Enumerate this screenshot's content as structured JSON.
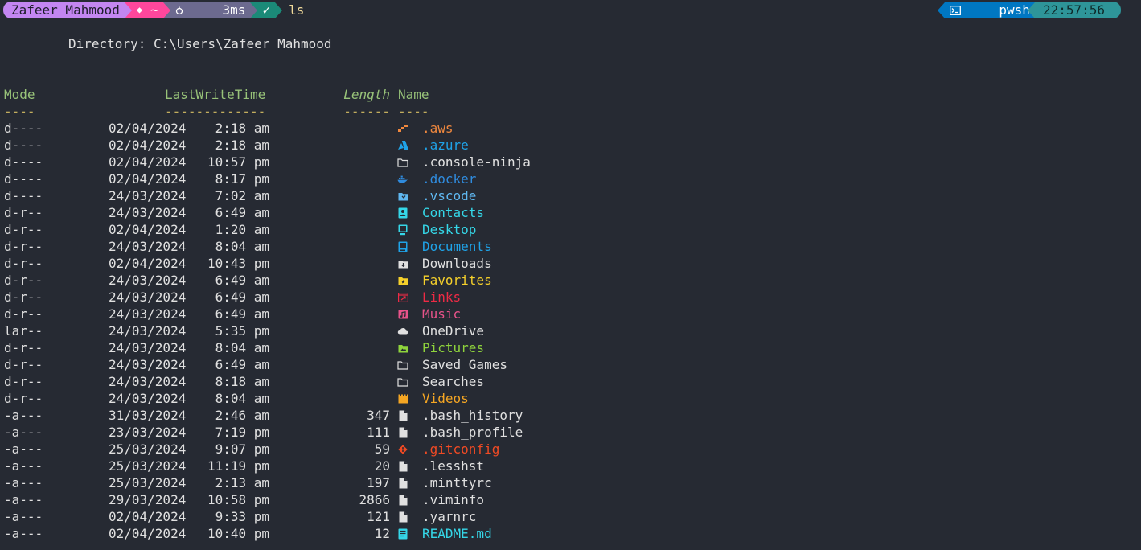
{
  "prompt": {
    "user": "Zafeer Mahmood",
    "git_glyph": "◆",
    "path": "~",
    "duration": "3ms",
    "status": "✓",
    "command": "ls",
    "shell": "pwsh",
    "time": "22:57:56"
  },
  "directory_line": "Directory: C:\\Users\\Zafeer Mahmood",
  "headers": {
    "mode": "Mode",
    "lastwritetime": "LastWriteTime",
    "length": "Length",
    "name": "Name",
    "mode_dash": "----",
    "lwt_dash": "-------------",
    "length_dash": "------",
    "name_dash": "----"
  },
  "colors": {
    "background": "#262a33",
    "user_seg": "#c386f1",
    "git_seg": "#ff479c",
    "path_seg": "#6c6a8f",
    "status_seg": "#1b8a78",
    "shell_seg": "#0077c2",
    "time_seg": "#2e9599"
  },
  "rows": [
    {
      "mode": "d----",
      "date": "02/04/2024",
      "time": "2:18 am",
      "length": "",
      "name": ".aws",
      "icon": "aws-icon",
      "color": "#f0883e"
    },
    {
      "mode": "d----",
      "date": "02/04/2024",
      "time": "2:18 am",
      "length": "",
      "name": ".azure",
      "icon": "azure-icon",
      "color": "#1fa3e8"
    },
    {
      "mode": "d----",
      "date": "02/04/2024",
      "time": "10:57 pm",
      "length": "",
      "name": ".console-ninja",
      "icon": "folder-icon",
      "color": "#e0e0e0"
    },
    {
      "mode": "d----",
      "date": "02/04/2024",
      "time": "8:17 pm",
      "length": "",
      "name": ".docker",
      "icon": "docker-icon",
      "color": "#2f8bde"
    },
    {
      "mode": "d----",
      "date": "24/03/2024",
      "time": "7:02 am",
      "length": "",
      "name": ".vscode",
      "icon": "vscode-icon",
      "color": "#5fb7f0"
    },
    {
      "mode": "d-r--",
      "date": "24/03/2024",
      "time": "6:49 am",
      "length": "",
      "name": "Contacts",
      "icon": "contacts-icon",
      "color": "#35d7e8"
    },
    {
      "mode": "d-r--",
      "date": "02/04/2024",
      "time": "1:20 am",
      "length": "",
      "name": "Desktop",
      "icon": "desktop-icon",
      "color": "#35d7e8"
    },
    {
      "mode": "d-r--",
      "date": "24/03/2024",
      "time": "8:04 am",
      "length": "",
      "name": "Documents",
      "icon": "documents-icon",
      "color": "#1fa3e8"
    },
    {
      "mode": "d-r--",
      "date": "02/04/2024",
      "time": "10:43 pm",
      "length": "",
      "name": "Downloads",
      "icon": "downloads-icon",
      "color": "#e0e0e0"
    },
    {
      "mode": "d-r--",
      "date": "24/03/2024",
      "time": "6:49 am",
      "length": "",
      "name": "Favorites",
      "icon": "favorites-icon",
      "color": "#f5d02b"
    },
    {
      "mode": "d-r--",
      "date": "24/03/2024",
      "time": "6:49 am",
      "length": "",
      "name": "Links",
      "icon": "links-icon",
      "color": "#ee2a45"
    },
    {
      "mode": "d-r--",
      "date": "24/03/2024",
      "time": "6:49 am",
      "length": "",
      "name": "Music",
      "icon": "music-icon",
      "color": "#e8538a"
    },
    {
      "mode": "lar--",
      "date": "24/03/2024",
      "time": "5:35 pm",
      "length": "",
      "name": "OneDrive",
      "icon": "cloud-icon",
      "color": "#e0e0e0"
    },
    {
      "mode": "d-r--",
      "date": "24/03/2024",
      "time": "8:04 am",
      "length": "",
      "name": "Pictures",
      "icon": "pictures-icon",
      "color": "#8fd43c"
    },
    {
      "mode": "d-r--",
      "date": "24/03/2024",
      "time": "6:49 am",
      "length": "",
      "name": "Saved Games",
      "icon": "folder-icon",
      "color": "#e0e0e0"
    },
    {
      "mode": "d-r--",
      "date": "24/03/2024",
      "time": "8:18 am",
      "length": "",
      "name": "Searches",
      "icon": "folder-icon",
      "color": "#e0e0e0"
    },
    {
      "mode": "d-r--",
      "date": "24/03/2024",
      "time": "8:04 am",
      "length": "",
      "name": "Videos",
      "icon": "videos-icon",
      "color": "#f5a623"
    },
    {
      "mode": "-a---",
      "date": "31/03/2024",
      "time": "2:46 am",
      "length": "347",
      "name": ".bash_history",
      "icon": "file-icon",
      "color": "#e0e0e0"
    },
    {
      "mode": "-a---",
      "date": "23/03/2024",
      "time": "7:19 pm",
      "length": "111",
      "name": ".bash_profile",
      "icon": "file-icon",
      "color": "#e0e0e0"
    },
    {
      "mode": "-a---",
      "date": "25/03/2024",
      "time": "9:07 pm",
      "length": "59",
      "name": ".gitconfig",
      "icon": "git-icon",
      "color": "#f04a24"
    },
    {
      "mode": "-a---",
      "date": "25/03/2024",
      "time": "11:19 pm",
      "length": "20",
      "name": ".lesshst",
      "icon": "file-icon",
      "color": "#e0e0e0"
    },
    {
      "mode": "-a---",
      "date": "25/03/2024",
      "time": "2:13 am",
      "length": "197",
      "name": ".minttyrc",
      "icon": "file-icon",
      "color": "#e0e0e0"
    },
    {
      "mode": "-a---",
      "date": "29/03/2024",
      "time": "10:58 pm",
      "length": "2866",
      "name": ".viminfo",
      "icon": "file-icon",
      "color": "#e0e0e0"
    },
    {
      "mode": "-a---",
      "date": "02/04/2024",
      "time": "9:33 pm",
      "length": "121",
      "name": ".yarnrc",
      "icon": "file-icon",
      "color": "#e0e0e0"
    },
    {
      "mode": "-a---",
      "date": "02/04/2024",
      "time": "10:40 pm",
      "length": "12",
      "name": "README.md",
      "icon": "markdown-icon",
      "color": "#35d7e8"
    }
  ]
}
